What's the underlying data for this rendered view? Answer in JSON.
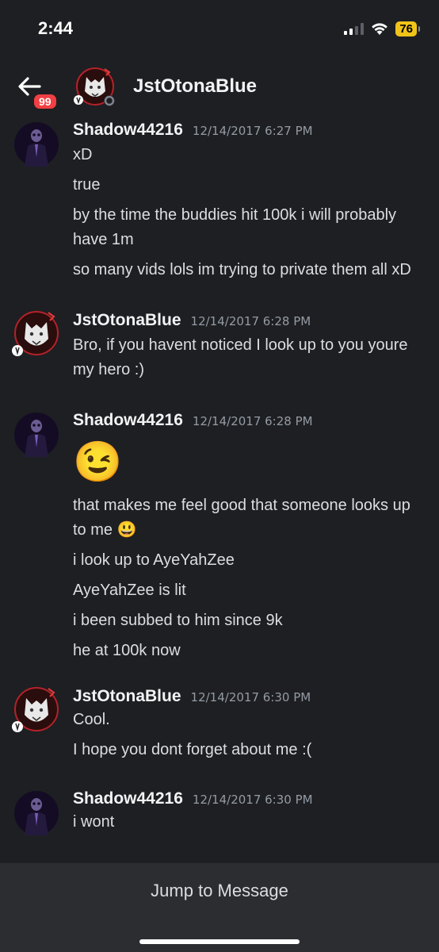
{
  "status_bar": {
    "time": "2:44",
    "battery": "76"
  },
  "header": {
    "unread_count": "99",
    "channel_name": "JstOtonaBlue"
  },
  "colors": {
    "background": "#1e1f22",
    "badge": "#f23f43",
    "battery": "#f0c419",
    "bottom_bar": "#2b2d31"
  },
  "messages": {
    "g1": {
      "username": "Shadow44216",
      "timestamp": "12/14/2017 6:27 PM",
      "lines": [
        "xD",
        "true",
        "by the time the buddies hit 100k i will probably have 1m",
        "so many vids lols im trying to private them all xD"
      ]
    },
    "g2": {
      "username": "JstOtonaBlue",
      "timestamp": "12/14/2017 6:28 PM",
      "lines": [
        "Bro, if you havent noticed I look up to you youre my hero :)"
      ]
    },
    "g3": {
      "username": "Shadow44216",
      "timestamp": "12/14/2017 6:28 PM",
      "emoji": "😉",
      "lines": [
        "that makes me feel good that someone looks up to me 😃",
        "i look up to AyeYahZee",
        "AyeYahZee is lit",
        "i been subbed to him since 9k",
        "he at 100k now"
      ]
    },
    "g4": {
      "username": "JstOtonaBlue",
      "timestamp": "12/14/2017 6:30 PM",
      "lines": [
        "Cool.",
        "I hope you dont forget about me :("
      ]
    },
    "g5": {
      "username": "Shadow44216",
      "timestamp": "12/14/2017 6:30 PM",
      "lines": [
        "i wont"
      ]
    }
  },
  "jump_button": {
    "label": "Jump to Message"
  }
}
